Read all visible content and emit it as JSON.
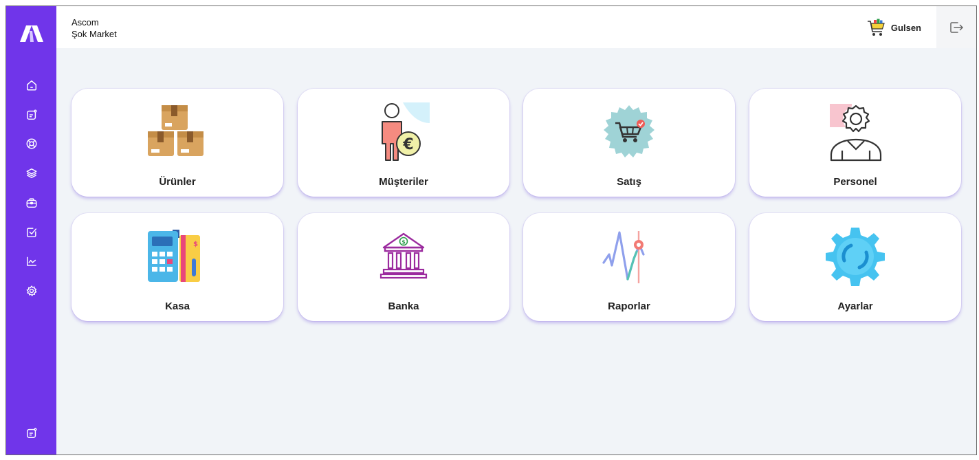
{
  "header": {
    "company_name": "Ascom",
    "store_name": "Şok Market",
    "user_name": "Gulsen"
  },
  "sidebar": {
    "logo": "brand-logo-icon",
    "items": [
      {
        "icon": "home-icon"
      },
      {
        "icon": "note-icon"
      },
      {
        "icon": "lifebuoy-icon"
      },
      {
        "icon": "layers-icon"
      },
      {
        "icon": "briefcase-icon"
      },
      {
        "icon": "checkbox-icon"
      },
      {
        "icon": "chart-icon"
      },
      {
        "icon": "gear-icon"
      }
    ],
    "bottom_item": {
      "icon": "note-icon"
    }
  },
  "tiles": [
    {
      "label": "Ürünler",
      "icon": "boxes-icon"
    },
    {
      "label": "Müşteriler",
      "icon": "customer-euro-icon"
    },
    {
      "label": "Satış",
      "icon": "shopping-cart-badge-icon"
    },
    {
      "label": "Personel",
      "icon": "person-gear-icon"
    },
    {
      "label": "Kasa",
      "icon": "cash-register-icon"
    },
    {
      "label": "Banka",
      "icon": "bank-icon"
    },
    {
      "label": "Raporlar",
      "icon": "line-graph-icon"
    },
    {
      "label": "Ayarlar",
      "icon": "settings-gear-icon"
    }
  ],
  "colors": {
    "sidebar": "#7035ea",
    "background": "#f1f4f8",
    "card": "#ffffff"
  }
}
